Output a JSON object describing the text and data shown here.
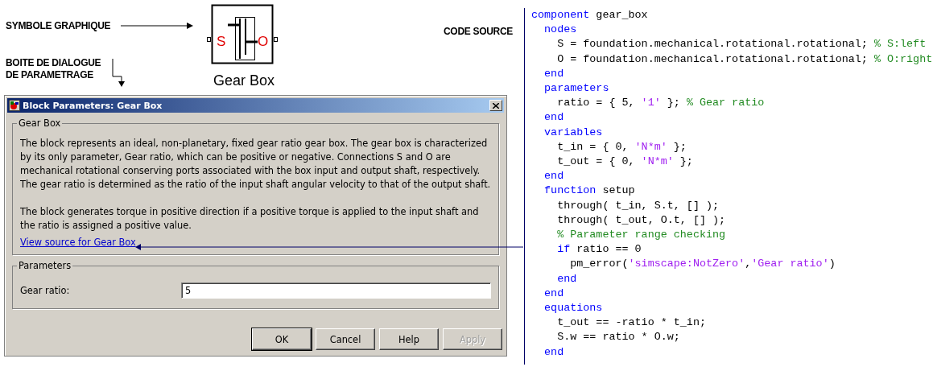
{
  "annotations": {
    "symbol_label": "SYMBOLE GRAPHIQUE",
    "dialog_label": [
      "BOITE DE DIALOGUE",
      "DE PARAMETRAGE"
    ],
    "code_label": "CODE SOURCE"
  },
  "block": {
    "name": "Gear Box",
    "left_port": "S",
    "right_port": "O"
  },
  "dialog": {
    "title": "Block Parameters: Gear Box",
    "description_group": "Gear Box",
    "paragraphs": [
      "The block represents an ideal, non-planetary, fixed gear ratio gear box. The gear box is characterized by its only parameter, Gear ratio, which can be positive or negative. Connections S and O are mechanical rotational conserving ports associated with the box input and output shaft, respectively. The gear ratio is determined as the ratio of the input shaft angular velocity to that of the output shaft.",
      "The block generates torque in positive direction if a positive torque is applied to the input shaft and the ratio is assigned a positive value."
    ],
    "link": "View source for Gear Box",
    "parameters_group": "Parameters",
    "fields": [
      {
        "label": "Gear ratio:",
        "value": "5"
      }
    ],
    "buttons": [
      {
        "label": "OK",
        "default": true,
        "disabled": false
      },
      {
        "label": "Cancel",
        "default": false,
        "disabled": false
      },
      {
        "label": "Help",
        "default": false,
        "disabled": false
      },
      {
        "label": "Apply",
        "default": false,
        "disabled": true
      }
    ]
  },
  "code": {
    "lines": [
      [
        {
          "kind": "keyword",
          "text": "component"
        },
        {
          "kind": "plain",
          "text": " gear_box"
        }
      ],
      [
        {
          "kind": "keyword",
          "text": "  nodes"
        }
      ],
      [
        {
          "kind": "plain",
          "text": "    S = foundation.mechanical.rotational.rotational; "
        },
        {
          "kind": "comment",
          "text": "% S:left"
        }
      ],
      [
        {
          "kind": "plain",
          "text": "    O = foundation.mechanical.rotational.rotational; "
        },
        {
          "kind": "comment",
          "text": "% O:right"
        }
      ],
      [
        {
          "kind": "keyword",
          "text": "  end"
        }
      ],
      [
        {
          "kind": "keyword",
          "text": "  parameters"
        }
      ],
      [
        {
          "kind": "plain",
          "text": "    ratio = { 5, "
        },
        {
          "kind": "string",
          "text": "'1'"
        },
        {
          "kind": "plain",
          "text": " }; "
        },
        {
          "kind": "comment",
          "text": "% Gear ratio"
        }
      ],
      [
        {
          "kind": "keyword",
          "text": "  end"
        }
      ],
      [
        {
          "kind": "keyword",
          "text": "  variables"
        }
      ],
      [
        {
          "kind": "plain",
          "text": "    t_in = { 0, "
        },
        {
          "kind": "string",
          "text": "'N*m'"
        },
        {
          "kind": "plain",
          "text": " };"
        }
      ],
      [
        {
          "kind": "plain",
          "text": "    t_out = { 0, "
        },
        {
          "kind": "string",
          "text": "'N*m'"
        },
        {
          "kind": "plain",
          "text": " };"
        }
      ],
      [
        {
          "kind": "keyword",
          "text": "  end"
        }
      ],
      [
        {
          "kind": "keyword",
          "text": "  function"
        },
        {
          "kind": "plain",
          "text": " setup"
        }
      ],
      [
        {
          "kind": "plain",
          "text": "    through( t_in, S.t, [] );"
        }
      ],
      [
        {
          "kind": "plain",
          "text": "    through( t_out, O.t, [] );"
        }
      ],
      [
        {
          "kind": "comment",
          "text": "    % Parameter range checking"
        }
      ],
      [
        {
          "kind": "keyword",
          "text": "    if"
        },
        {
          "kind": "plain",
          "text": " ratio == 0"
        }
      ],
      [
        {
          "kind": "plain",
          "text": "      pm_error("
        },
        {
          "kind": "string",
          "text": "'simscape:NotZero'"
        },
        {
          "kind": "plain",
          "text": ","
        },
        {
          "kind": "string",
          "text": "'Gear ratio'"
        },
        {
          "kind": "plain",
          "text": ")"
        }
      ],
      [
        {
          "kind": "keyword",
          "text": "    end"
        }
      ],
      [
        {
          "kind": "keyword",
          "text": "  end"
        }
      ],
      [
        {
          "kind": "keyword",
          "text": "  equations"
        }
      ],
      [
        {
          "kind": "plain",
          "text": "    t_out == -ratio * t_in;"
        }
      ],
      [
        {
          "kind": "plain",
          "text": "    S.w == ratio * O.w;"
        }
      ],
      [
        {
          "kind": "keyword",
          "text": "  end"
        }
      ]
    ]
  }
}
